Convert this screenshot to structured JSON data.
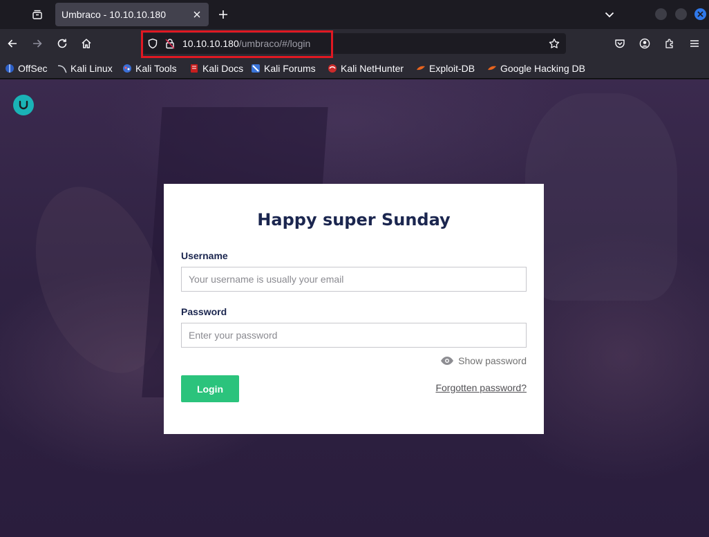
{
  "browser": {
    "tab_title": "Umbraco - 10.10.10.180",
    "url_host": "10.10.10.180",
    "url_path": "/umbraco/#/login",
    "bookmarks": [
      "OffSec",
      "Kali Linux",
      "Kali Tools",
      "Kali Docs",
      "Kali Forums",
      "Kali NetHunter",
      "Exploit-DB",
      "Google Hacking DB"
    ]
  },
  "login": {
    "title": "Happy super Sunday",
    "username_label": "Username",
    "username_placeholder": "Your username is usually your email",
    "password_label": "Password",
    "password_placeholder": "Enter your password",
    "show_password": "Show password",
    "login_button": "Login",
    "forgot_link": "Forgotten password?"
  },
  "colors": {
    "accent_green": "#2bc37c",
    "umbraco_teal": "#1ab3b6",
    "url_highlight": "#e01822"
  }
}
